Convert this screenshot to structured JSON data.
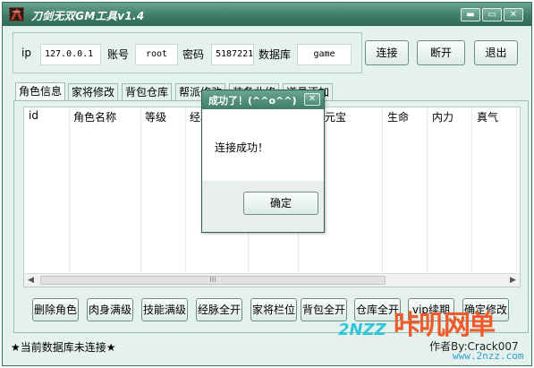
{
  "window": {
    "title": "刀剑无双GM工具v1.4",
    "icon": "sword-logo-icon",
    "controls": {
      "minimize": "▬",
      "maximize": "▭",
      "close": "✕"
    }
  },
  "connection": {
    "ip_label": "ip",
    "ip_value": "127.0.0.1",
    "account_label": "账号",
    "account_value": "root",
    "password_label": "密码",
    "password_value": "5187221",
    "database_label": "数据库",
    "database_value": "game"
  },
  "buttons": {
    "connect": "连接",
    "disconnect": "断开",
    "exit": "退出"
  },
  "tabs": [
    {
      "label": "角色信息",
      "active": true
    },
    {
      "label": "家将修改"
    },
    {
      "label": "背包仓库"
    },
    {
      "label": "帮派修改"
    },
    {
      "label": "装备此修"
    },
    {
      "label": "道具添加"
    }
  ],
  "grid": {
    "columns": [
      "id",
      "角色名称",
      "等级",
      "经验",
      "",
      "绑定元宝",
      "生命",
      "内力",
      "真气"
    ],
    "scroll_thumb_grip": "III"
  },
  "actions": [
    "删除角色",
    "肉身满级",
    "技能满级",
    "经脉全开",
    "家将栏位",
    "背包全开",
    "仓库全开",
    "vip续期",
    "确定修改"
  ],
  "status": {
    "text": "★当前数据库未连接★",
    "author": "作者By:Crack007"
  },
  "dialog": {
    "title": "成功了！(^^o^^)",
    "message": "连接成功！",
    "ok": "确定",
    "close": "✕"
  },
  "watermark": {
    "brand": "2NZZ",
    "cn": "咔叽网单",
    "url": "www.2nzz.com"
  },
  "colors": {
    "title_bar": "#3f7d66",
    "background": "#e4f1ec",
    "watermark_orange": "#f15a2a",
    "watermark_cyan": "#32c6d8"
  }
}
